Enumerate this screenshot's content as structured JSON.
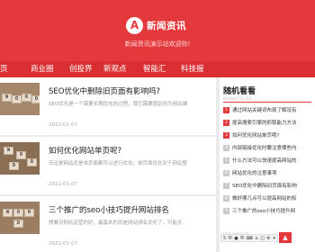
{
  "header": {
    "logo_letter": "A",
    "site_name": "新闻资讯",
    "tagline": "新闻资讯演示站欢迎你!"
  },
  "nav": {
    "items": [
      "页",
      "商业圈",
      "创投界",
      "新观点",
      "智能汇",
      "科技报"
    ]
  },
  "posts": [
    {
      "title": "SEO优化中删除旧页面有影响吗?",
      "excerpt": "SEO优化是一个需要长期优化的过程，我们需要固定的为网站编",
      "date": "2022-01-07",
      "thumb_label": "WORDS"
    },
    {
      "title": "如何优化网站单页呢?",
      "excerpt": "无论是网站还是单页面都可以进行优化。单页面优化对于网站整",
      "date": "2022-01-07",
      "thumb_label": "WORDS"
    },
    {
      "title": "三个推广的seo小技巧提升网站排名",
      "excerpt": "想要对网站运营的好，最基本的就是网站排名优化了，可能大",
      "date": "2022-01-07",
      "thumb_label": "WORDS"
    }
  ],
  "sidebar": {
    "title": "随机看看",
    "subtitle": "NEWARTICLES",
    "items": [
      {
        "num": "1",
        "text": "通过网站关键词布局了解没有"
      },
      {
        "num": "2",
        "text": "提高搜索引擎的抓取能力方法"
      },
      {
        "num": "3",
        "text": "如何优化网站单页呢?"
      },
      {
        "num": "4",
        "text": "内部链接优化时要注意哪些内"
      },
      {
        "num": "5",
        "text": "什么方法可以快速提高网站的"
      },
      {
        "num": "6",
        "text": "网站优化的注意事项"
      },
      {
        "num": "7",
        "text": "SEO优化中删除旧页面有影响"
      },
      {
        "num": "8",
        "text": "做好哪几点可以提高网站的权"
      },
      {
        "num": "9",
        "text": "三个推广的seo小技巧提升网"
      }
    ],
    "footer_sub": "HOT ARTICLES"
  },
  "widget": {
    "labels": [
      "S",
      "中",
      "●",
      "中",
      "⌨",
      "♙",
      "◫",
      "⚙",
      "✈"
    ]
  },
  "colors": {
    "accent": "#e4393c",
    "nav_bg": "#d92f32",
    "page_bg": "#ebebeb"
  }
}
